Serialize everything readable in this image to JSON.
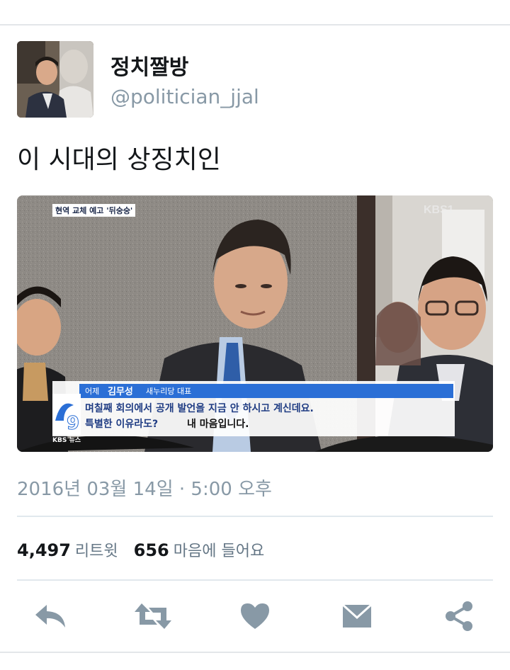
{
  "user": {
    "display_name": "정치짤방",
    "handle": "@politician_jjal"
  },
  "tweet": {
    "text": "이 시대의 상징치인",
    "timestamp": "2016년 03월 14일 · 5:00 오후"
  },
  "media": {
    "topic_banner": "현역 교체 예고 '뒤숭숭'",
    "channel_logo": "KBS1",
    "speaker_tag": "어제",
    "speaker_name": "김무성",
    "speaker_title": "새누리당 대표",
    "subtitle_line1": "며칠째 회의에서 공개 발언을 지금 안 하시고 계신데요.",
    "subtitle_line2_a": "특별한 이유라도?",
    "subtitle_line2_b": "내 마음입니다.",
    "news_label": "KBS 뉴스"
  },
  "stats": {
    "retweets_count": "4,497",
    "retweets_label": "리트윗",
    "likes_count": "656",
    "likes_label": "마음에 들어요"
  },
  "colors": {
    "icon": "#8899a6",
    "text_secondary": "#8899a6",
    "divider": "#e1e8ed",
    "caption_blue": "#2b6fd6"
  },
  "icons": [
    "reply-icon",
    "retweet-icon",
    "heart-icon",
    "message-icon",
    "share-icon"
  ]
}
